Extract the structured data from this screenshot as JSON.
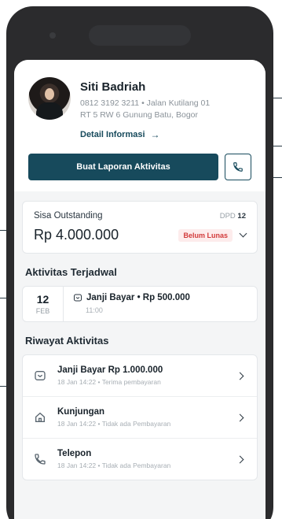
{
  "profile": {
    "name": "Siti Badriah",
    "phone": "0812 3192 3211",
    "address_line1": "Jalan Kutilang 01",
    "address_line2": "RT 5 RW 6 Gunung Batu, Bogor",
    "separator": "•",
    "detail_link": "Detail Informasi",
    "detail_arrow": "→"
  },
  "actions": {
    "primary_label": "Buat Laporan Aktivitas",
    "phone_icon": "phone-icon"
  },
  "outstanding": {
    "title": "Sisa Outstanding",
    "dpd_label": "DPD",
    "dpd_value": "12",
    "amount": "Rp 4.000.000",
    "status": "Belum Lunas"
  },
  "scheduled": {
    "section_title": "Aktivitas Terjadwal",
    "items": [
      {
        "day": "12",
        "month": "FEB",
        "title": "Janji Bayar • Rp 500.000",
        "time": "11:00",
        "icon": "promise-icon"
      }
    ]
  },
  "history": {
    "section_title": "Riwayat Aktivitas",
    "items": [
      {
        "title": "Janji Bayar Rp 1.000.000",
        "subtitle": "18 Jan 14:22 • Terima pembayaran",
        "icon": "promise-icon"
      },
      {
        "title": "Kunjungan",
        "subtitle": "18 Jan 14:22 • Tidak ada Pembayaran",
        "icon": "home-icon"
      },
      {
        "title": "Telepon",
        "subtitle": "18 Jan 14:22 • Tidak ada Pembayaran",
        "icon": "phone-icon"
      }
    ]
  },
  "colors": {
    "primary": "#174a5c",
    "badge_text": "#d23a3a",
    "badge_bg": "#fdecec",
    "frame": "#2b2b2d"
  }
}
